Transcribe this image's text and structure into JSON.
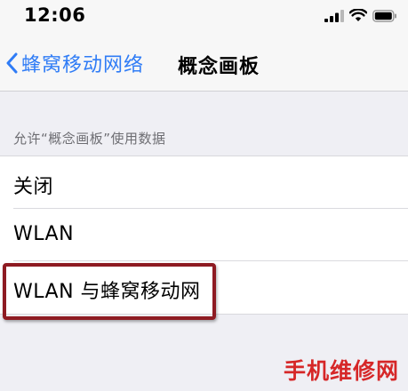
{
  "status_bar": {
    "time": "12:06",
    "icons": [
      "signal-icon",
      "wifi-icon",
      "battery-icon"
    ]
  },
  "nav": {
    "back_label": "蜂窝移动网络",
    "title": "概念画板",
    "accent_color": "#2f7cf6"
  },
  "section": {
    "header": "允许“概念画板”使用数据",
    "options": [
      {
        "label": "关闭"
      },
      {
        "label": "WLAN"
      },
      {
        "label": "WLAN 与蜂窝移动网"
      }
    ]
  },
  "annotation": {
    "highlight_color": "#8e1b22"
  },
  "watermark": {
    "text": "手机维修网",
    "color": "#d62728"
  }
}
